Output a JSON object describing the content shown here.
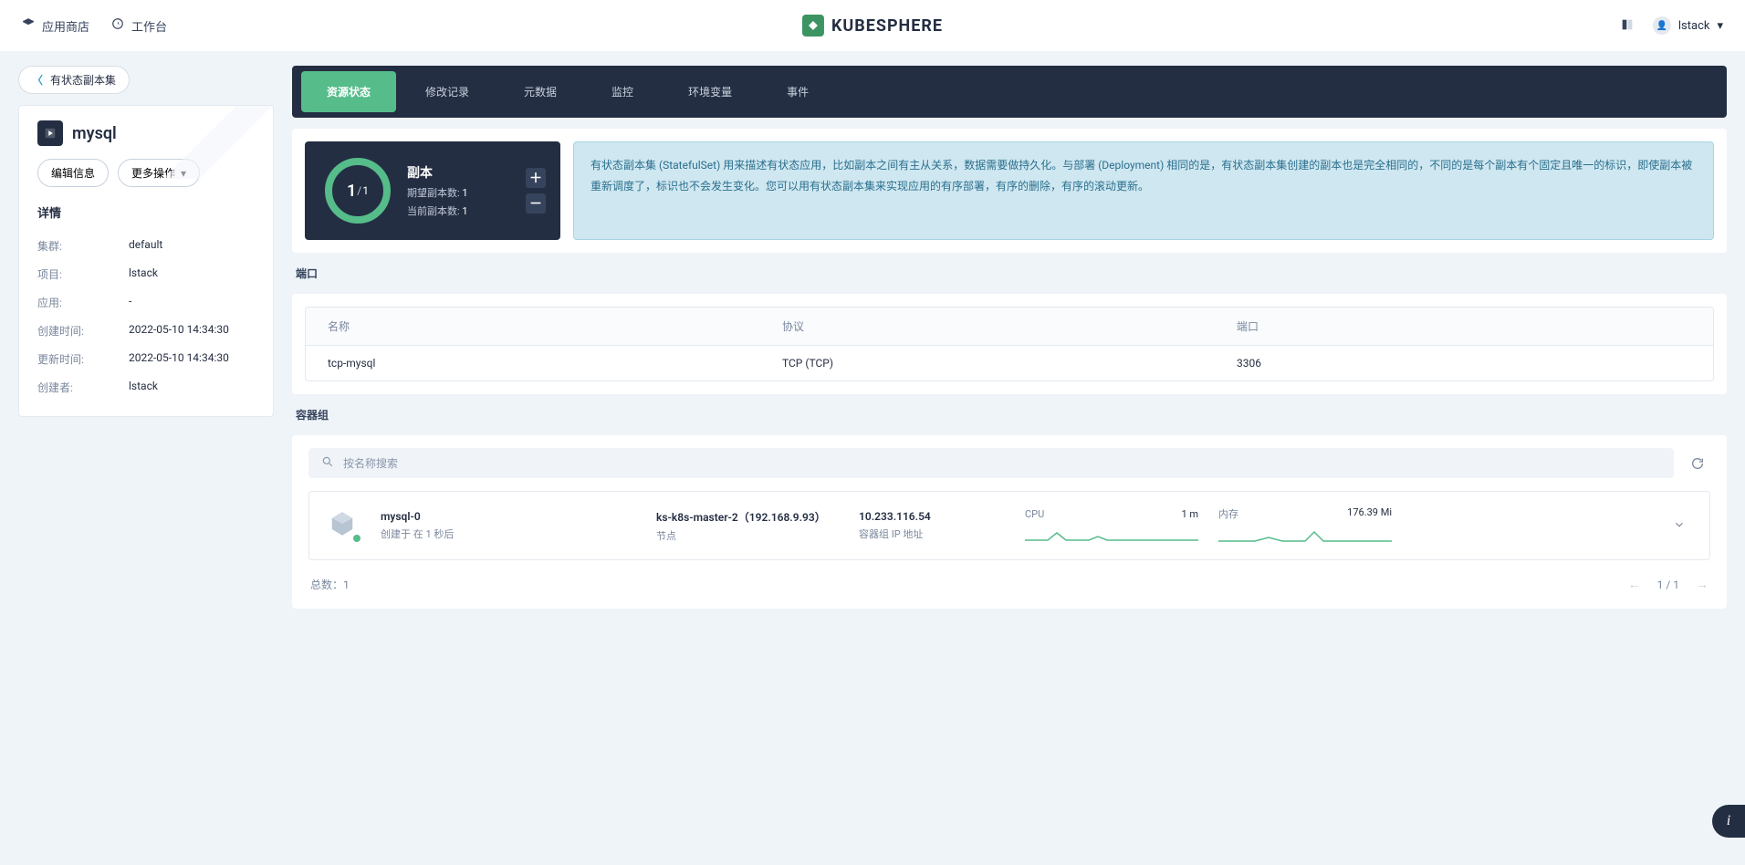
{
  "topbar": {
    "appStore": "应用商店",
    "workbench": "工作台",
    "brand": "KUBESPHERE",
    "username": "lstack"
  },
  "side": {
    "backLabel": "有状态副本集",
    "resourceName": "mysql",
    "editBtn": "编辑信息",
    "moreBtn": "更多操作",
    "detailsHeader": "详情",
    "rows": [
      {
        "k": "集群:",
        "v": "default"
      },
      {
        "k": "项目:",
        "v": "lstack"
      },
      {
        "k": "应用:",
        "v": "-"
      },
      {
        "k": "创建时间:",
        "v": "2022-05-10 14:34:30"
      },
      {
        "k": "更新时间:",
        "v": "2022-05-10 14:34:30"
      },
      {
        "k": "创建者:",
        "v": "lstack"
      }
    ]
  },
  "tabs": [
    {
      "label": "资源状态",
      "active": true
    },
    {
      "label": "修改记录"
    },
    {
      "label": "元数据"
    },
    {
      "label": "监控"
    },
    {
      "label": "环境变量"
    },
    {
      "label": "事件"
    }
  ],
  "replica": {
    "title": "副本",
    "ready": "1",
    "total": "1",
    "desiredLabel": "期望副本数:",
    "desiredValue": "1",
    "currentLabel": "当前副本数:",
    "currentValue": "1"
  },
  "banner": "有状态副本集 (StatefulSet) 用来描述有状态应用，比如副本之间有主从关系，数据需要做持久化。与部署 (Deployment) 相同的是，有状态副本集创建的副本也是完全相同的，不同的是每个副本有个固定且唯一的标识，即使副本被重新调度了，标识也不会发生变化。您可以用有状态副本集来实现应用的有序部署，有序的删除，有序的滚动更新。",
  "ports": {
    "section": "端口",
    "headers": {
      "name": "名称",
      "protocol": "协议",
      "port": "端口"
    },
    "rows": [
      {
        "name": "tcp-mysql",
        "protocol": "TCP (TCP)",
        "port": "3306"
      }
    ]
  },
  "pods": {
    "section": "容器组",
    "searchPlaceholder": "按名称搜索",
    "list": [
      {
        "name": "mysql-0",
        "createdText": "创建于 在 1 秒后",
        "node": "ks-k8s-master-2（192.168.9.93）",
        "nodeLabel": "节点",
        "ip": "10.233.116.54",
        "ipLabel": "容器组 IP 地址",
        "cpuLabel": "CPU",
        "cpuValue": "1 m",
        "memLabel": "内存",
        "memValue": "176.39 Mi"
      }
    ],
    "totalLabel": "总数：",
    "total": "1",
    "pageText": "1 / 1"
  }
}
